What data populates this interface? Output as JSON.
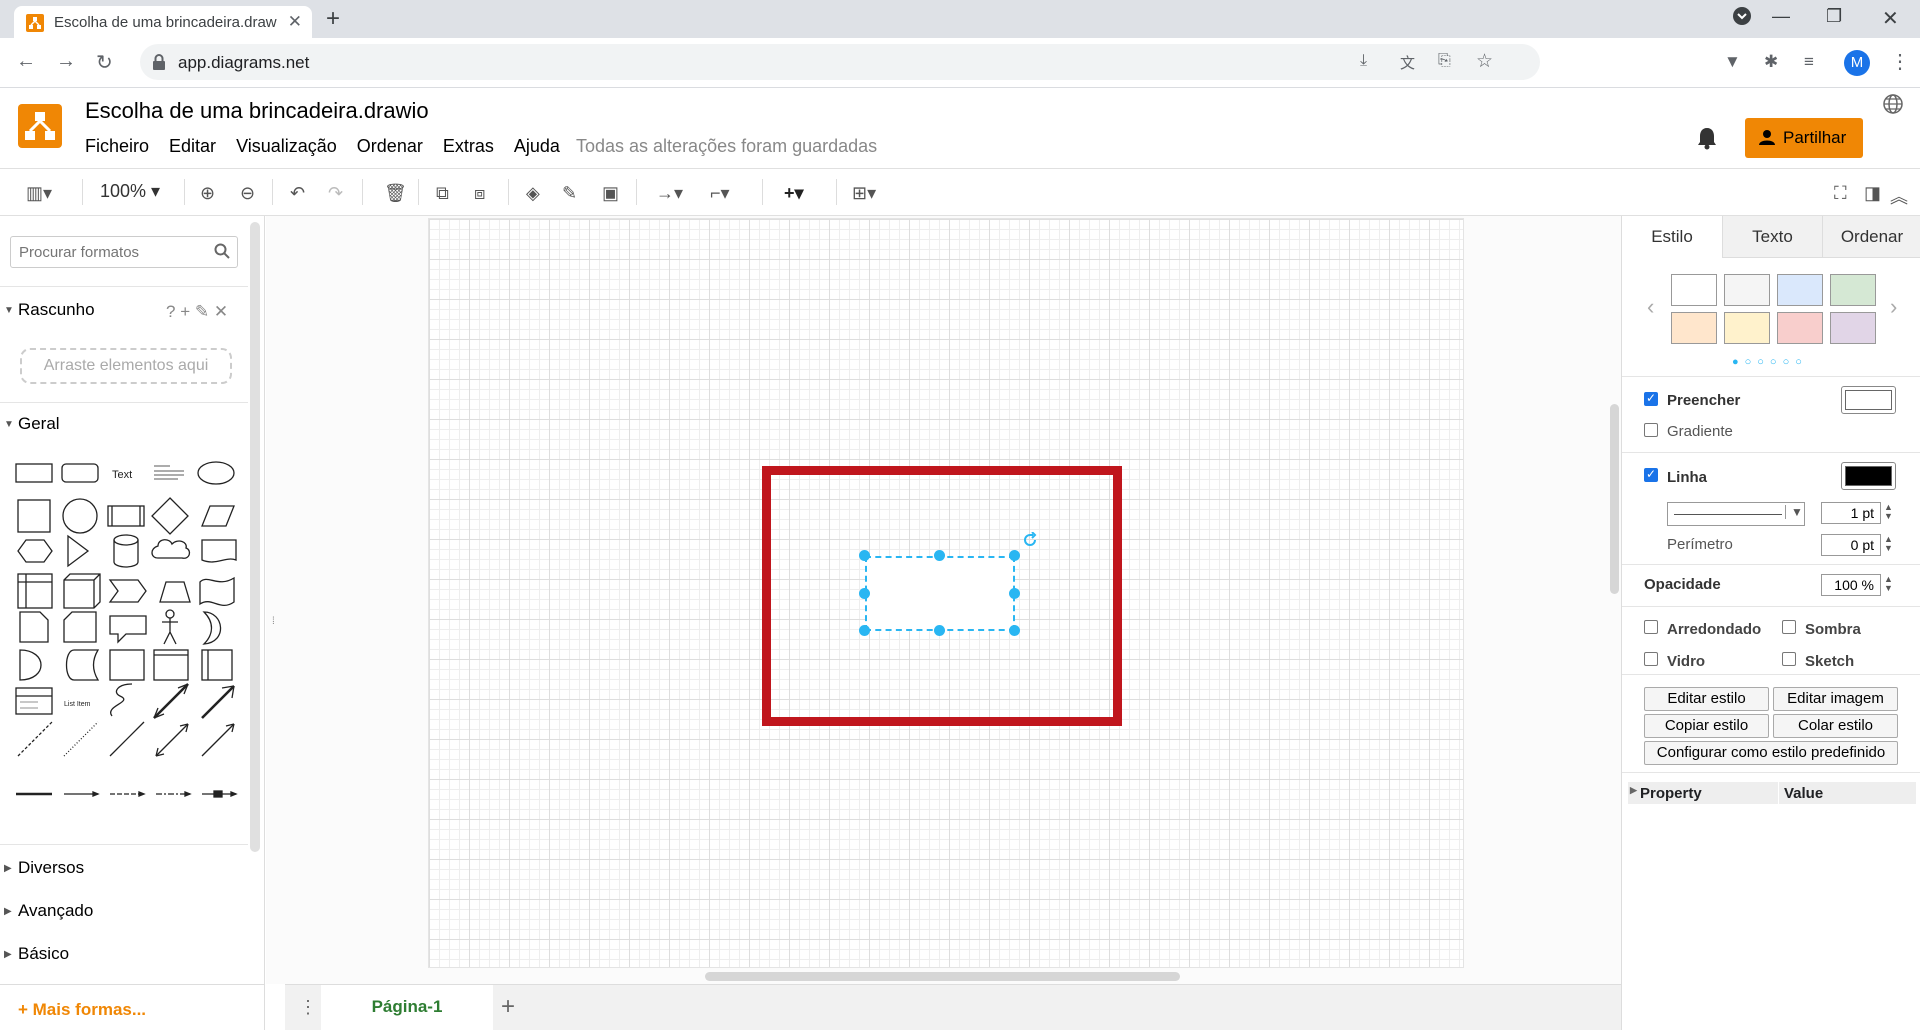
{
  "browser": {
    "tab_title": "Escolha de uma brincadeira.draw",
    "url": "app.diagrams.net",
    "avatar_letter": "M"
  },
  "app": {
    "doc_title": "Escolha de uma brincadeira.drawio",
    "menu": [
      "Ficheiro",
      "Editar",
      "Visualização",
      "Ordenar",
      "Extras",
      "Ajuda"
    ],
    "save_status": "Todas as alterações foram guardadas",
    "share_label": "Partilhar",
    "brand_color": "#f08705"
  },
  "toolbar": {
    "zoom": "100%"
  },
  "sidebar": {
    "search_placeholder": "Procurar formatos",
    "scratch_title": "Rascunho",
    "scratch_hint": "Arraste elementos aqui",
    "general_title": "Geral",
    "text_shape": "Text",
    "list_item_shape": "List Item",
    "collapsed_sections": [
      "Diversos",
      "Avançado",
      "Básico"
    ],
    "more_shapes": "+ Mais formas..."
  },
  "canvas": {
    "highlight_color": "#c0161d",
    "selection_color": "#29b6f2"
  },
  "pages": {
    "current": "Página-1"
  },
  "format_panel": {
    "tabs": [
      "Estilo",
      "Texto",
      "Ordenar"
    ],
    "swatch_colors": [
      "#ffffff",
      "#f5f5f5",
      "#dae8fc",
      "#d5e8d4",
      "#ffe6cc",
      "#fff2cc",
      "#f8cecc",
      "#e1d5e7"
    ],
    "fill_label": "Preencher",
    "fill_checked": true,
    "fill_color": "#ffffff",
    "gradient_label": "Gradiente",
    "line_label": "Linha",
    "line_checked": true,
    "line_color": "#000000",
    "line_width": "1 pt",
    "perimeter_label": "Perímetro",
    "perimeter_value": "0 pt",
    "opacity_label": "Opacidade",
    "opacity_value": "100 %",
    "rounded_label": "Arredondado",
    "shadow_label": "Sombra",
    "glass_label": "Vidro",
    "sketch_label": "Sketch",
    "btn_edit_style": "Editar estilo",
    "btn_edit_image": "Editar imagem",
    "btn_copy_style": "Copiar estilo",
    "btn_paste_style": "Colar estilo",
    "btn_default_style": "Configurar como estilo predefinido",
    "prop_header": "Property",
    "value_header": "Value"
  }
}
